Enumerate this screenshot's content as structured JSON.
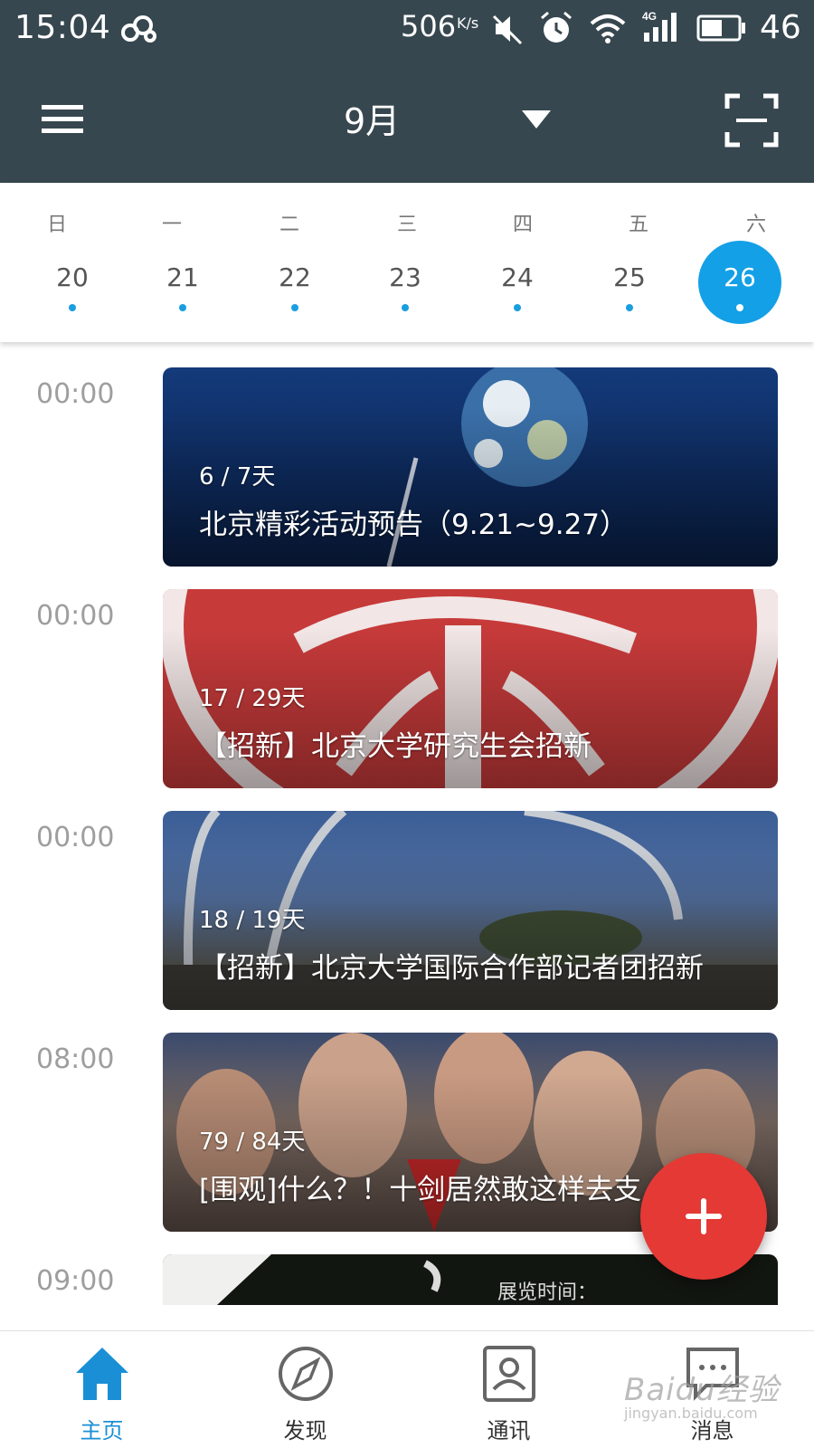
{
  "status_bar": {
    "time": "15:04",
    "net_speed": "506",
    "net_speed_unit": "K/s",
    "battery_pct": "46",
    "icons": [
      "cloud-icon",
      "mute-icon",
      "alarm-icon",
      "wifi-icon",
      "signal-4g-icon",
      "battery-icon"
    ]
  },
  "app_bar": {
    "month": "9月",
    "menu_icon": "hamburger-menu-icon",
    "dropdown_icon": "caret-down-icon",
    "scan_icon": "scan-icon"
  },
  "week": {
    "weekdays": [
      "日",
      "一",
      "二",
      "三",
      "四",
      "五",
      "六"
    ],
    "days": [
      "20",
      "21",
      "22",
      "23",
      "24",
      "25",
      "26"
    ],
    "selected": "26"
  },
  "events": [
    {
      "time": "00:00",
      "progress": "6 / 7天",
      "title": "北京精彩活动预告（9.21~9.27）"
    },
    {
      "time": "00:00",
      "progress": "17 / 29天",
      "title": "【招新】北京大学研究生会招新"
    },
    {
      "time": "00:00",
      "progress": "18 / 19天",
      "title": "【招新】北京大学国际合作部记者团招新"
    },
    {
      "time": "08:00",
      "progress": "79 / 84天",
      "title": "[围观]什么？！十剑居然敢这样去支"
    },
    {
      "time": "09:00",
      "caption": "展览时间："
    }
  ],
  "fab": {
    "icon": "plus-icon"
  },
  "bottom_nav": [
    {
      "label": "主页",
      "icon": "home-icon",
      "active": true
    },
    {
      "label": "发现",
      "icon": "compass-icon",
      "active": false
    },
    {
      "label": "通讯",
      "icon": "contact-card-icon",
      "active": false
    },
    {
      "label": "消息",
      "icon": "message-icon",
      "active": false
    }
  ],
  "watermark": {
    "text": "Baidu经验",
    "sub": "jingyan.baidu.com"
  },
  "colors": {
    "app_bar": "#37474f",
    "accent_blue": "#14a0e6",
    "fab_red": "#e53935",
    "time_gray": "#9e9e9e"
  }
}
